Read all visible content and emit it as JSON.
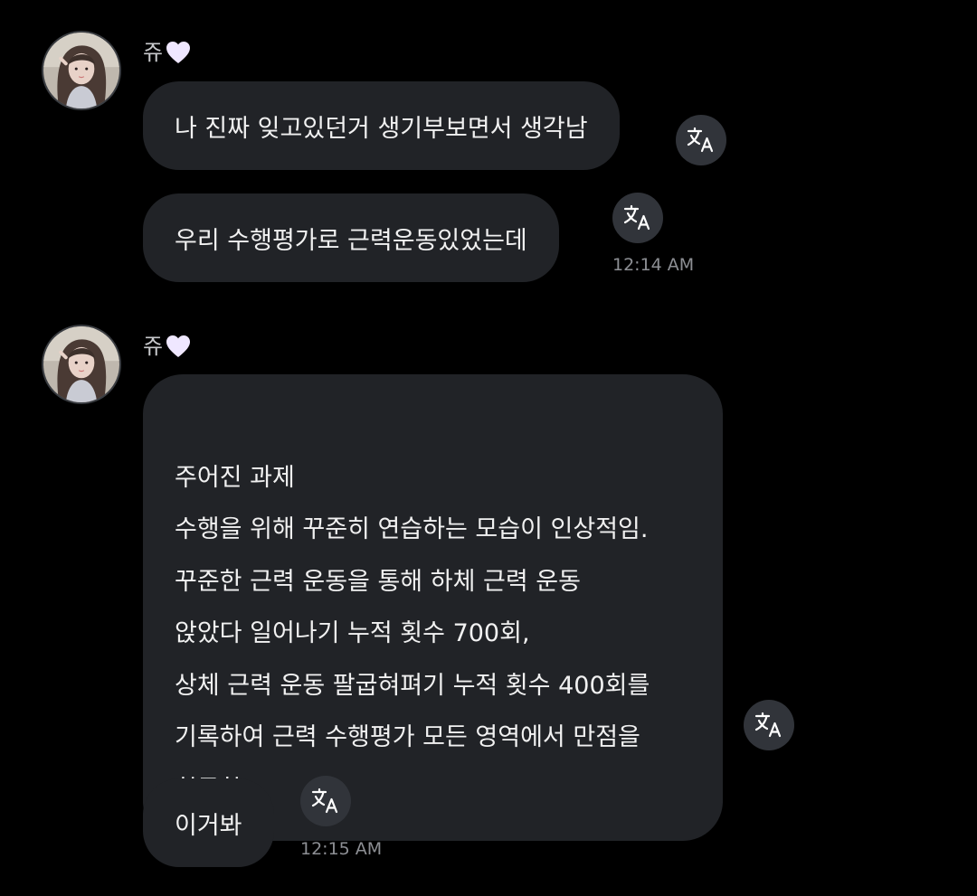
{
  "chat": {
    "sender_name": "쥬",
    "sender_emoji": "white-heart-icon",
    "groups": [
      {
        "messages": [
          "나 진짜 잊고있던거 생기부보면서 생각남",
          "우리 수행평가로 근력운동있었는데"
        ],
        "time": "12:14 AM"
      },
      {
        "messages": [
          "주어진 과제\n수행을 위해 꾸준히 연습하는 모습이 인상적임.\n꾸준한 근력 운동을 통해 하체 근력 운동\n앉았다 일어나기 누적 횟수 700회,\n상체 근력 운동 팔굽혀펴기 누적 횟수 400회를\n기록하여 근력 수행평가 모든 영역에서 만점을\n획득함.",
          "이거봐"
        ],
        "time": "12:15 AM"
      }
    ]
  },
  "colors": {
    "background": "#000000",
    "bubble": "#212327",
    "translate_button": "#31343a",
    "timestamp": "#8d8f94",
    "sender_name": "#c8c9cc",
    "heart": "#efe7ff"
  },
  "icons": {
    "translate": "translate-icon",
    "avatar": "avatar"
  }
}
